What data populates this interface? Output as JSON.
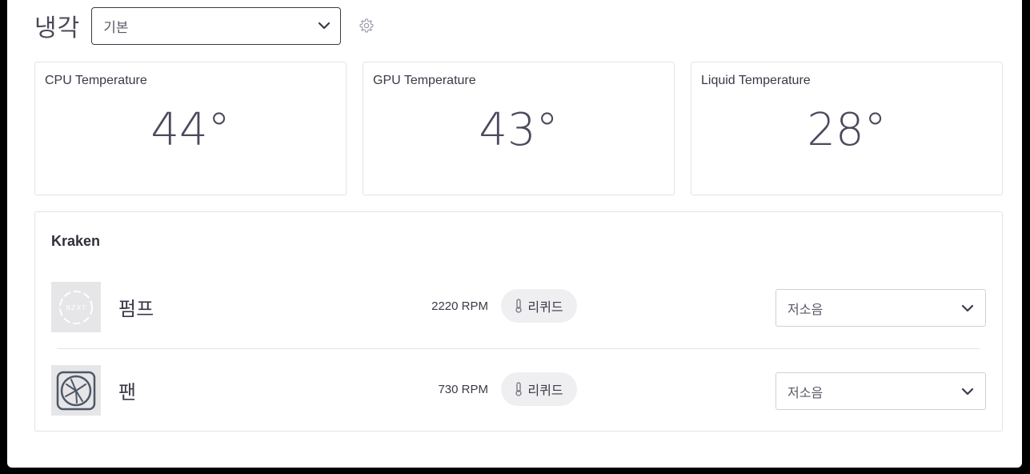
{
  "header": {
    "title": "냉각",
    "profile": {
      "selected": "기본"
    },
    "settings_icon": "gear-icon"
  },
  "temperatures": [
    {
      "label": "CPU Temperature",
      "value": "44°"
    },
    {
      "label": "GPU Temperature",
      "value": "43°"
    },
    {
      "label": "Liquid Temperature",
      "value": "28°"
    }
  ],
  "kraken": {
    "title": "Kraken",
    "devices": [
      {
        "name": "펌프",
        "rpm": "2220 RPM",
        "source": "리퀴드",
        "source_icon": "thermometer-icon",
        "mode": "저소음",
        "thumbnail": "nzxt-logo"
      },
      {
        "name": "팬",
        "rpm": "730 RPM",
        "source": "리퀴드",
        "source_icon": "thermometer-icon",
        "mode": "저소음",
        "thumbnail": "fan-icon"
      }
    ]
  }
}
